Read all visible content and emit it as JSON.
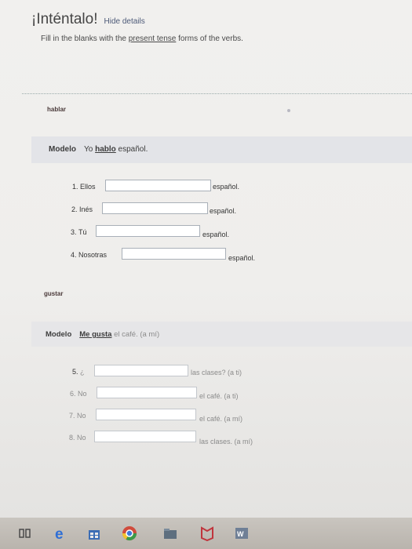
{
  "header": {
    "title": "¡Inténtalo!",
    "hide_details": "Hide details",
    "instructions_pre": "Fill in the blanks with the ",
    "instructions_link": "present tense",
    "instructions_post": " forms of the verbs."
  },
  "section1": {
    "verb": "hablar",
    "modelo_label": "Modelo",
    "modelo_pre": "Yo ",
    "modelo_verb": "hablo",
    "modelo_post": " español.",
    "items": [
      {
        "num": "1.",
        "subject": "Ellos",
        "value": "",
        "after": "español."
      },
      {
        "num": "2.",
        "subject": "Inés",
        "value": "",
        "after": "español."
      },
      {
        "num": "3.",
        "subject": "Tú",
        "value": "",
        "after": "español."
      },
      {
        "num": "4.",
        "subject": "Nosotras",
        "value": "",
        "after": "español."
      }
    ]
  },
  "section2": {
    "verb": "gustar",
    "modelo_label": "Modelo",
    "modelo_verb": "Me gusta",
    "modelo_post": " el café. (a mí)",
    "items": [
      {
        "num": "5.",
        "subject": "¿",
        "value": "",
        "after": "las clases? (a ti)"
      },
      {
        "num": "6.",
        "subject": "No",
        "value": "",
        "after": "el café. (a ti)"
      },
      {
        "num": "7.",
        "subject": "No",
        "value": "",
        "after": "el café. (a mí)"
      },
      {
        "num": "8.",
        "subject": "No",
        "value": "",
        "after": "las clases. (a mí)"
      }
    ]
  },
  "taskbar": {
    "icons": [
      "task-view-icon",
      "edge-icon",
      "store-icon",
      "chrome-icon",
      "file-explorer-icon",
      "mcafee-icon",
      "word-icon"
    ]
  },
  "colors": {
    "panel": "#e3e4e8",
    "input_border": "#a9b0b8",
    "link": "#4d5a78"
  }
}
